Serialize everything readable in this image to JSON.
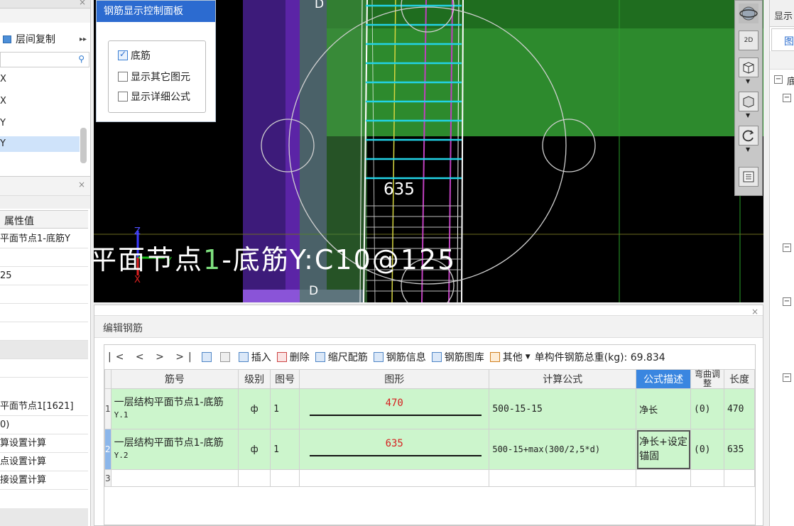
{
  "left_panel": {
    "floor_copy_label": "层间复制",
    "tree_items": [
      "X",
      "X",
      "Y",
      "Y"
    ],
    "property_header": "属性值",
    "property_rows": [
      "平面节点1-底筋Y",
      "",
      "25",
      "",
      "",
      "",
      "",
      "",
      "平面节点1[1621]",
      "0)",
      "算设置计算",
      "点设置计算",
      "接设置计算",
      ""
    ]
  },
  "control_panel": {
    "title": "钢筋显示控制面板",
    "options": [
      {
        "label": "底筋",
        "checked": true
      },
      {
        "label": "显示其它图元",
        "checked": false
      },
      {
        "label": "显示详细公式",
        "checked": false
      }
    ]
  },
  "viewport": {
    "element_label_prefix": "平面节点",
    "element_label_number": "1",
    "element_label_suffix": "-底筋Y:C10@125",
    "dimension_label": "635",
    "marker_top": "D",
    "marker_bottom": "D",
    "axis_labels": {
      "z": "Z",
      "y": "Y",
      "x": "X"
    }
  },
  "view_tools": {
    "items": [
      "orbit-icon",
      "2d-view-icon",
      "3d-box-icon",
      "cube-view-icon",
      "rotate-icon",
      "layers-icon"
    ],
    "label_2d": "2D"
  },
  "right_panel": {
    "header": "显示",
    "tab": "图",
    "tree_text": "底"
  },
  "editor": {
    "title": "编辑钢筋",
    "nav": "|< < > >|",
    "toolbar": {
      "insert": "插入",
      "delete": "删除",
      "scale_rebar": "缩尺配筋",
      "rebar_info": "钢筋信息",
      "rebar_library": "钢筋图库",
      "other": "其他",
      "total_weight": "单构件钢筋总重(kg): 69.834"
    },
    "columns": [
      "筋号",
      "级别",
      "图号",
      "图形",
      "计算公式",
      "公式描述",
      "弯曲调整",
      "长度"
    ],
    "rows": [
      {
        "index": "1",
        "name": "一层结构平面节点1-底筋",
        "name_sub": "Y.1",
        "grade": "ф",
        "figure_no": "1",
        "shape_value": "470",
        "formula": "500-15-15",
        "description": "净长",
        "bend_adjust": "(0)",
        "length": "470"
      },
      {
        "index": "2",
        "name": "一层结构平面节点1-底筋",
        "name_sub": "Y.2",
        "grade": "ф",
        "figure_no": "1",
        "shape_value": "635",
        "formula": "500-15+max(300/2,5*d)",
        "description": "净长+设定锚固",
        "bend_adjust": "(0)",
        "length": "635"
      },
      {
        "index": "3",
        "name": "",
        "name_sub": "",
        "grade": "",
        "figure_no": "",
        "shape_value": "",
        "formula": "",
        "description": "",
        "bend_adjust": "",
        "length": ""
      }
    ]
  },
  "colors": {
    "accent": "#2c6bd0",
    "row_green": "#ccf5cc",
    "header_highlight": "#3a86e0",
    "shape_value": "#d62020",
    "viewport_green": "#2d8a2d",
    "viewport_purple": "#6a2bb8",
    "rebar_cyan": "#22d3e6"
  }
}
